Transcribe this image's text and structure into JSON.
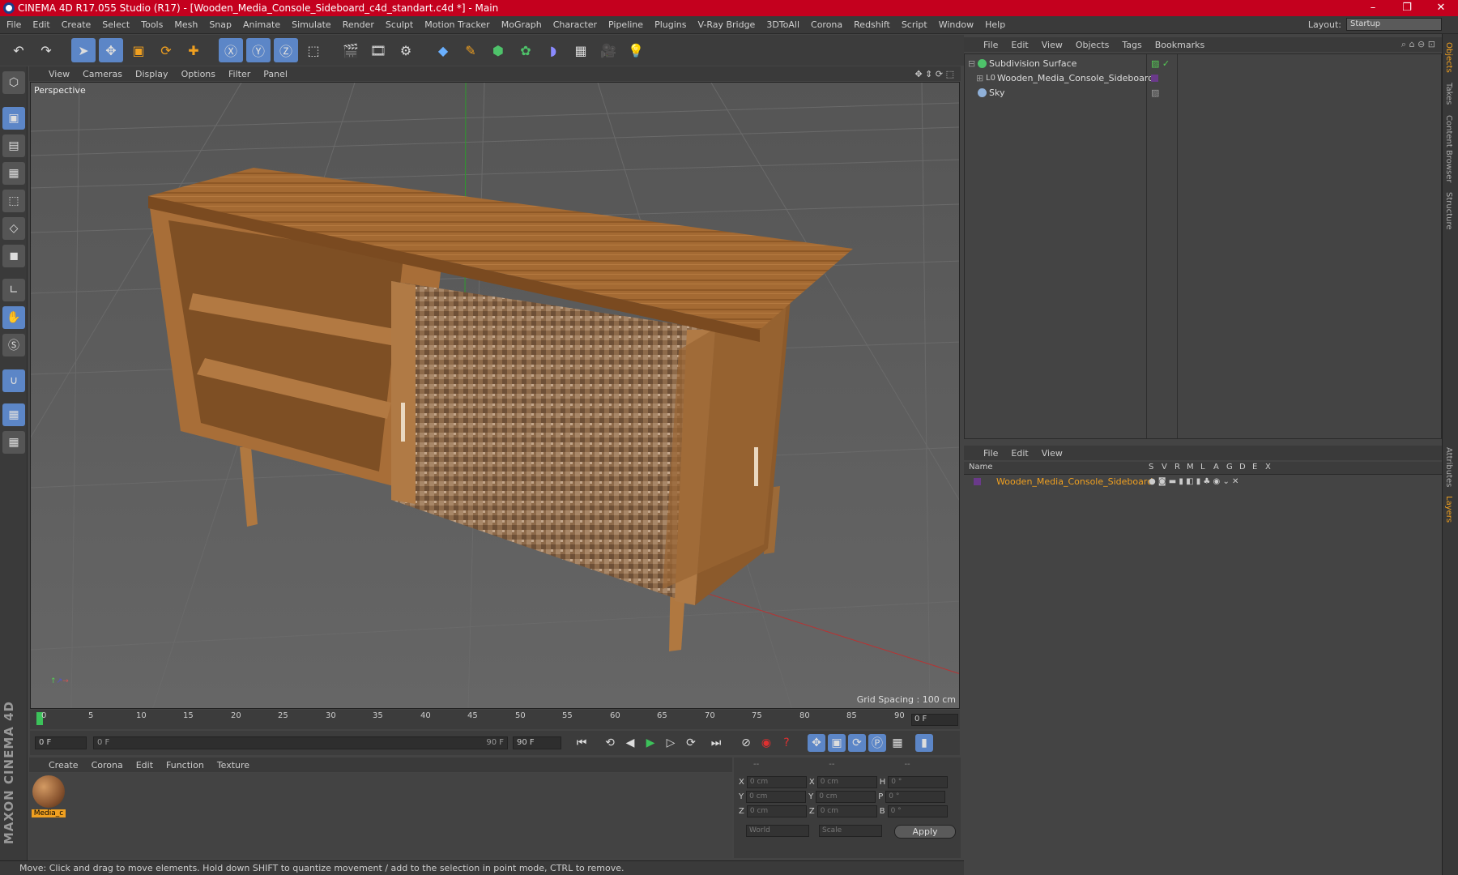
{
  "window": {
    "title": "CINEMA 4D R17.055 Studio (R17) - [Wooden_Media_Console_Sideboard_c4d_standart.c4d *] - Main",
    "controls": [
      "–",
      "❐",
      "✕"
    ]
  },
  "menubar": {
    "items": [
      "File",
      "Edit",
      "Create",
      "Select",
      "Tools",
      "Mesh",
      "Snap",
      "Animate",
      "Simulate",
      "Render",
      "Sculpt",
      "Motion Tracker",
      "MoGraph",
      "Character",
      "Pipeline",
      "Plugins",
      "V-Ray Bridge",
      "3DToAll",
      "Corona",
      "Redshift",
      "Script",
      "Window",
      "Help"
    ],
    "layout_label": "Layout:",
    "layout_value": "Startup"
  },
  "viewport": {
    "menu": [
      "View",
      "Cameras",
      "Display",
      "Options",
      "Filter",
      "Panel"
    ],
    "label": "Perspective",
    "grid_spacing": "Grid Spacing : 100 cm"
  },
  "timeline": {
    "ticks": [
      "0",
      "5",
      "10",
      "15",
      "20",
      "25",
      "30",
      "35",
      "40",
      "45",
      "50",
      "55",
      "60",
      "65",
      "70",
      "75",
      "80",
      "85",
      "90"
    ],
    "current_frame": "0 F",
    "start_field": "0 F",
    "range_start": "0 F",
    "range_end": "90 F",
    "end_field": "90 F"
  },
  "material_manager": {
    "menu": [
      "Create",
      "Corona",
      "Edit",
      "Function",
      "Texture"
    ],
    "material_name": "Media_c"
  },
  "coordinates": {
    "headers": [
      "--",
      "--",
      "--"
    ],
    "rows": [
      {
        "a": "X",
        "av": "0 cm",
        "b": "X",
        "bv": "0 cm",
        "c": "H",
        "cv": "0 °"
      },
      {
        "a": "Y",
        "av": "0 cm",
        "b": "Y",
        "bv": "0 cm",
        "c": "P",
        "cv": "0 °"
      },
      {
        "a": "Z",
        "av": "0 cm",
        "b": "Z",
        "bv": "0 cm",
        "c": "B",
        "cv": "0 °"
      }
    ],
    "mode1": "World",
    "mode2": "Scale",
    "apply": "Apply"
  },
  "object_manager": {
    "menu": [
      "File",
      "Edit",
      "View",
      "Objects",
      "Tags",
      "Bookmarks"
    ],
    "objects": [
      "Subdivision Surface",
      "Wooden_Media_Console_Sideboard",
      "Sky"
    ]
  },
  "layer_manager": {
    "menu": [
      "File",
      "Edit",
      "View"
    ],
    "columns": [
      "Name",
      "S",
      "V",
      "R",
      "M",
      "L",
      "A",
      "G",
      "D",
      "E",
      "X"
    ],
    "layer_name": "Wooden_Media_Console_Sideboard"
  },
  "right_tabs": [
    "Objects",
    "Takes",
    "Content Browser",
    "Structure",
    "Attributes",
    "Layers"
  ],
  "status": "Move: Click and drag to move elements. Hold down SHIFT to quantize movement / add to the selection in point mode, CTRL to remove.",
  "colors": {
    "accent": "#5c86c7",
    "title": "#c4001e",
    "layer": "#f0a020"
  }
}
